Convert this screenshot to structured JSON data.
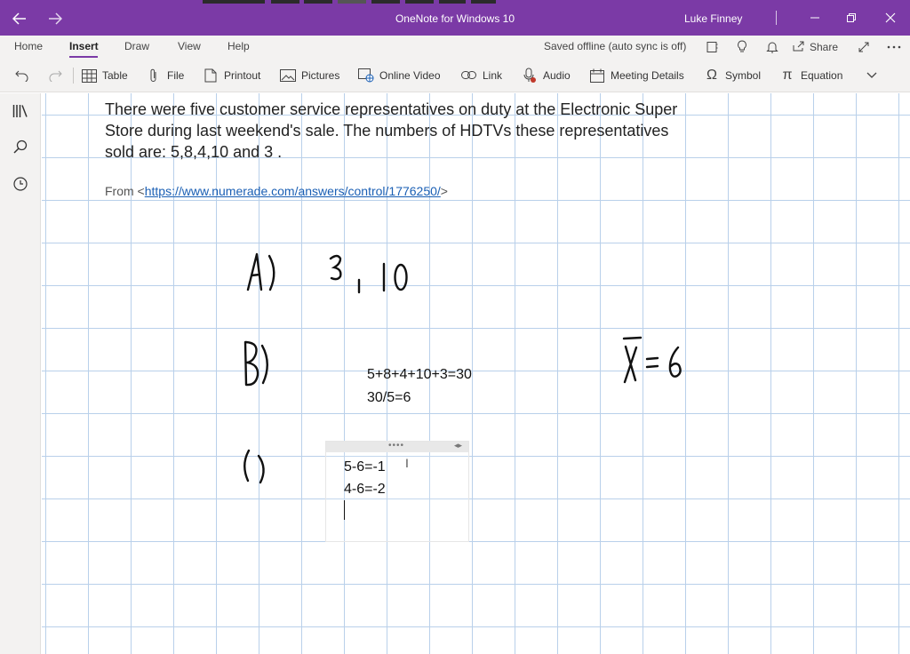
{
  "window": {
    "title": "OneNote for Windows 10",
    "user": "Luke Finney",
    "back_icon": "back-arrow-icon",
    "forward_icon": "forward-arrow-icon",
    "accent": "#7b3aa6"
  },
  "ribbon": {
    "tabs": [
      "Home",
      "Insert",
      "Draw",
      "View",
      "Help"
    ],
    "active_tab": "Insert",
    "sync_status": "Saved offline (auto sync is off)",
    "share_label": "Share"
  },
  "toolbar": {
    "items": [
      {
        "label": "Table",
        "icon": "table-icon"
      },
      {
        "label": "File",
        "icon": "paperclip-icon"
      },
      {
        "label": "Printout",
        "icon": "printout-icon"
      },
      {
        "label": "Pictures",
        "icon": "picture-icon"
      },
      {
        "label": "Online Video",
        "icon": "online-video-icon"
      },
      {
        "label": "Link",
        "icon": "link-icon"
      },
      {
        "label": "Audio",
        "icon": "audio-icon"
      },
      {
        "label": "Meeting Details",
        "icon": "calendar-icon"
      },
      {
        "label": "Symbol",
        "icon": "omega-icon"
      },
      {
        "label": "Equation",
        "icon": "pi-icon"
      }
    ]
  },
  "page": {
    "question": "There were five customer service representatives on duty at the Electronic Super Store during last weekend's sale. The numbers of HDTVs these representatives sold are: 5,8,4,10 and 3 .",
    "source_prefix": "From <",
    "source_link": "https://www.numerade.com/answers/control/1776250/",
    "source_suffix": ">",
    "typed_sum": "5+8+4+10+3=30",
    "typed_mean": "30/5=6",
    "note_lines": [
      "5-6=-1",
      "4-6=-2"
    ],
    "handwriting": {
      "a_label": "A)",
      "a_answer": "3, 10",
      "b_label": "B)",
      "mean_notation": "x̄ = 6",
      "c_label": "C)"
    }
  }
}
